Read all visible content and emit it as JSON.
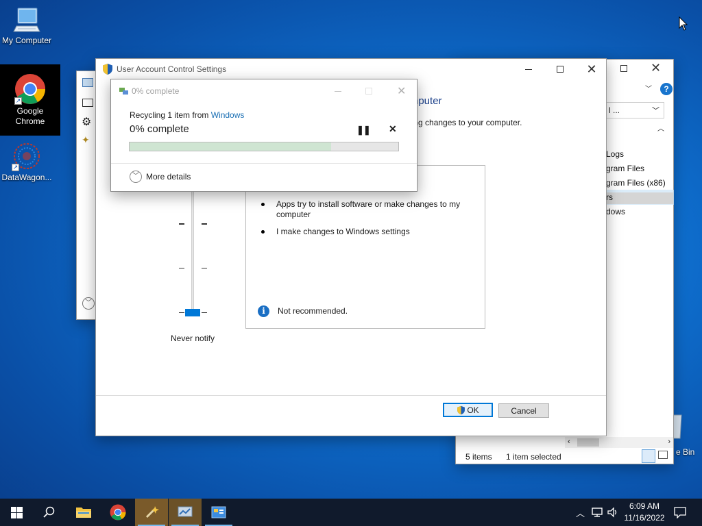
{
  "desktop": {
    "icons": [
      {
        "label": "My Computer"
      },
      {
        "label_line1": "Google",
        "label_line2": "Chrome"
      },
      {
        "label": "DataWagon..."
      },
      {
        "label": "e Bin"
      }
    ]
  },
  "explorer": {
    "address_fragment": "l ...",
    "items": [
      "Logs",
      "gram Files",
      "gram Files (x86)",
      "rs",
      "dows"
    ],
    "status_items": "5 items",
    "status_selected": "1 item selected"
  },
  "uac": {
    "title": "User Account Control Settings",
    "heading_fragment": "nputer",
    "subtext_fragment": "making changes to your computer.",
    "bullets": [
      "Apps try to install software or make changes to my computer",
      "I make changes to Windows settings"
    ],
    "note": "Not recommended.",
    "slider_label": "Never notify",
    "slider_level": 0,
    "ok_label": "OK",
    "cancel_label": "Cancel"
  },
  "progress": {
    "title": "0% complete",
    "line_prefix": "Recycling 1 item from ",
    "line_link": "Windows",
    "status": "0% complete",
    "fraction_filled": 0.75,
    "more_details": "More details"
  },
  "taskbar": {
    "time": "6:09 AM",
    "date": "11/16/2022"
  },
  "colors": {
    "accent": "#0078d7",
    "link": "#1a6fb4",
    "progress_fill": "#06b025",
    "taskbar": "#101a2c"
  }
}
